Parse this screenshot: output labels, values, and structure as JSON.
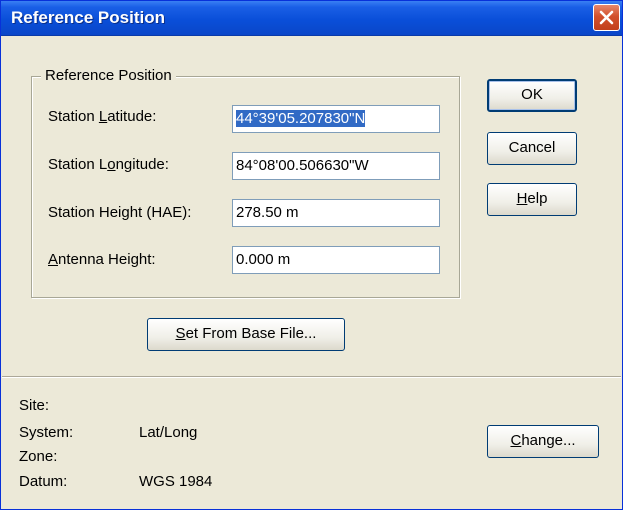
{
  "window": {
    "title": "Reference Position"
  },
  "group": {
    "label": "Reference Position",
    "fields": [
      {
        "label_pre": "Station ",
        "label_accel": "L",
        "label_post": "atitude:",
        "value": "44°39'05.207830\"N"
      },
      {
        "label_pre": "Station L",
        "label_accel": "o",
        "label_post": "ngitude:",
        "value": "84°08'00.506630\"W"
      },
      {
        "label_pre": "Station Hei",
        "label_accel": "g",
        "label_post": "ht (HAE):",
        "value": "278.50 m"
      },
      {
        "label_pre": "",
        "label_accel": "A",
        "label_post": "ntenna Height:",
        "value": "0.000 m"
      }
    ]
  },
  "buttons": {
    "ok": "OK",
    "cancel": "Cancel",
    "help_accel": "H",
    "help_rest": "elp",
    "set_accel": "S",
    "set_rest": "et From Base File...",
    "change_accel": "C",
    "change_rest": "hange..."
  },
  "info": {
    "site_label": "Site:",
    "system_label": "System:",
    "system_value": "Lat/Long",
    "zone_label": "Zone:",
    "datum_label": "Datum:",
    "datum_value": "WGS 1984"
  }
}
